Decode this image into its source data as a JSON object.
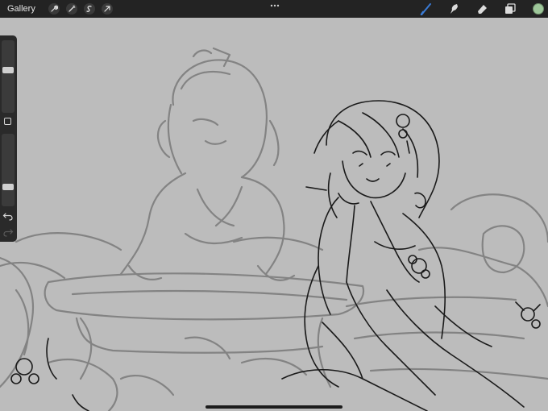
{
  "topbar": {
    "gallery_label": "Gallery",
    "actions": [
      "wrench-icon",
      "magic-wand-icon",
      "selection-icon",
      "transform-arrow-icon"
    ],
    "tools": [
      "brush-icon",
      "smudge-icon",
      "eraser-icon",
      "layers-icon"
    ],
    "active_tool": "brush-icon",
    "accent_color": "#3a7bd5",
    "current_color": "#9ec79a"
  },
  "sidebar": {
    "brush_size_level": 0.6,
    "opacity_level": 0.25,
    "icons": [
      "modify-square-icon",
      "undo-icon",
      "redo-icon"
    ]
  },
  "canvas": {
    "background_color": "#bcbcbc",
    "sketch_color": "#7a7a7a",
    "lineart_color": "#1a1a1a"
  }
}
